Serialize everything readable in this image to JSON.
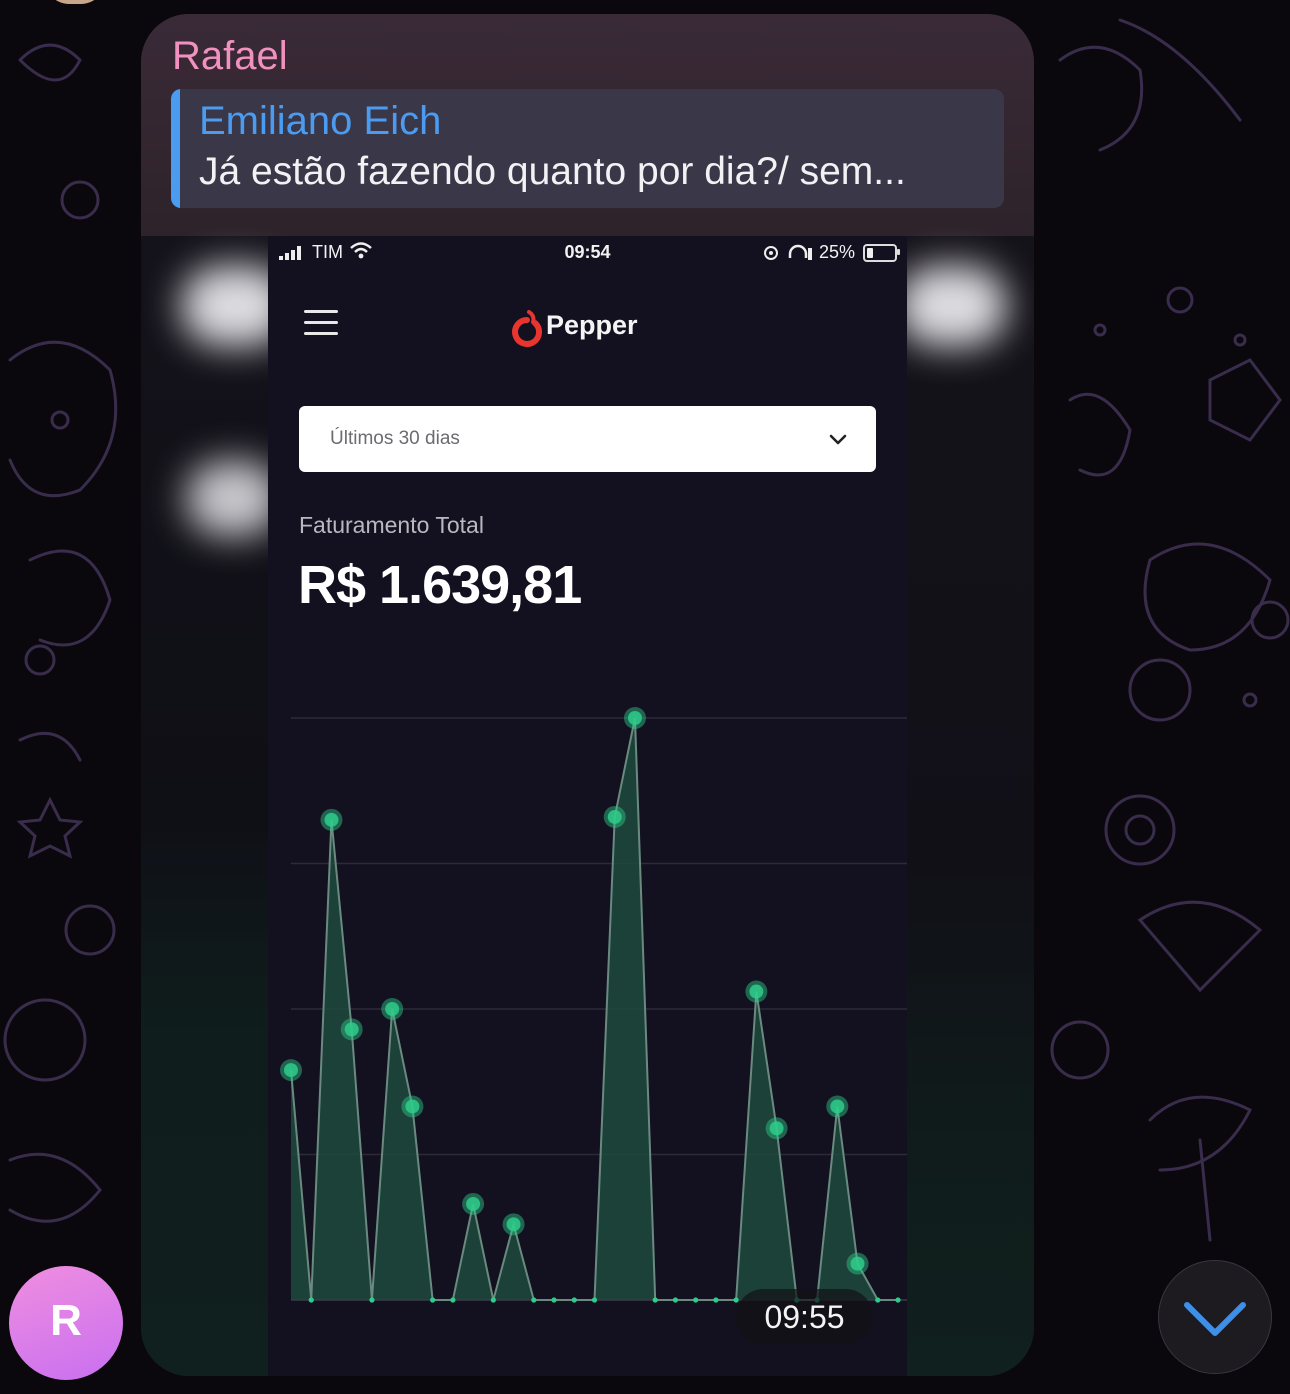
{
  "message": {
    "sender": "Rafael",
    "reply": {
      "author": "Emiliano Eich",
      "text": "Já estão fazendo quanto por dia?/ sem..."
    },
    "timestamp": "09:55"
  },
  "screenshot": {
    "status_bar": {
      "carrier": "TIM",
      "time": "09:54",
      "battery": "25%"
    },
    "app": {
      "brand": "Pepper",
      "period_select": "Últimos 30 dias",
      "metric_label": "Faturamento Total",
      "metric_value": "R$ 1.639,81"
    },
    "chart_data": {
      "type": "area",
      "title": "",
      "xlabel": "",
      "ylabel": "",
      "ylim": [
        0,
        4
      ],
      "grid": true,
      "series": [
        {
          "values": [
            1.58,
            0,
            3.3,
            1.86,
            0,
            2.0,
            1.33,
            0,
            0,
            0.66,
            0,
            0.52,
            0,
            0,
            0,
            0,
            3.32,
            4.0,
            0,
            0,
            0,
            0,
            0,
            2.12,
            1.18,
            0,
            0,
            1.33,
            0.25,
            0,
            0
          ]
        }
      ],
      "color": "#2ecc8a"
    }
  },
  "avatar_initial": "R",
  "icons": {
    "menu": "hamburger-icon",
    "dropdown": "chevron-down-icon",
    "scroll": "chevron-down-icon",
    "logo": "pepper-logo-icon"
  }
}
